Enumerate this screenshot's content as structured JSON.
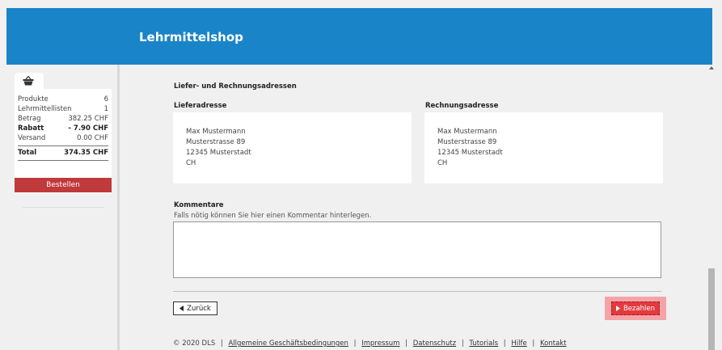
{
  "header": {
    "title": "Lehrmittelshop"
  },
  "sidebar": {
    "basket": {
      "rows": [
        {
          "label": "Produkte",
          "value": "6"
        },
        {
          "label": "Lehrmittellisten",
          "value": "1"
        },
        {
          "label": "Betrag",
          "value": "382.25 CHF"
        },
        {
          "label": "Rabatt",
          "value": "- 7.90 CHF"
        },
        {
          "label": "Versand",
          "value": "0.00 CHF"
        }
      ],
      "total": {
        "label": "Total",
        "value": "374.35 CHF"
      }
    },
    "order_label": "Bestellen"
  },
  "main": {
    "section_title": "Liefer- und Rechnungsadressen",
    "delivery": {
      "title": "Lieferadresse",
      "lines": [
        "Max Mustermann",
        "Musterstrasse 89",
        "12345 Musterstadt",
        "CH"
      ]
    },
    "billing": {
      "title": "Rechnungsadresse",
      "lines": [
        "Max Mustermann",
        "Musterstrasse 89",
        "12345 Musterstadt",
        "CH"
      ]
    },
    "comments": {
      "title": "Kommentare",
      "hint": "Falls nötig können Sie hier einen Kommentar hinterlegen.",
      "value": ""
    },
    "back_label": "Zurück",
    "pay_label": "Bezahlen"
  },
  "footer": {
    "copyright": "© 2020 DLS",
    "links": [
      "Allgemeine Geschäftsbedingungen",
      "Impressum",
      "Datenschutz",
      "Tutorials",
      "Hilfe",
      "Kontakt"
    ]
  }
}
